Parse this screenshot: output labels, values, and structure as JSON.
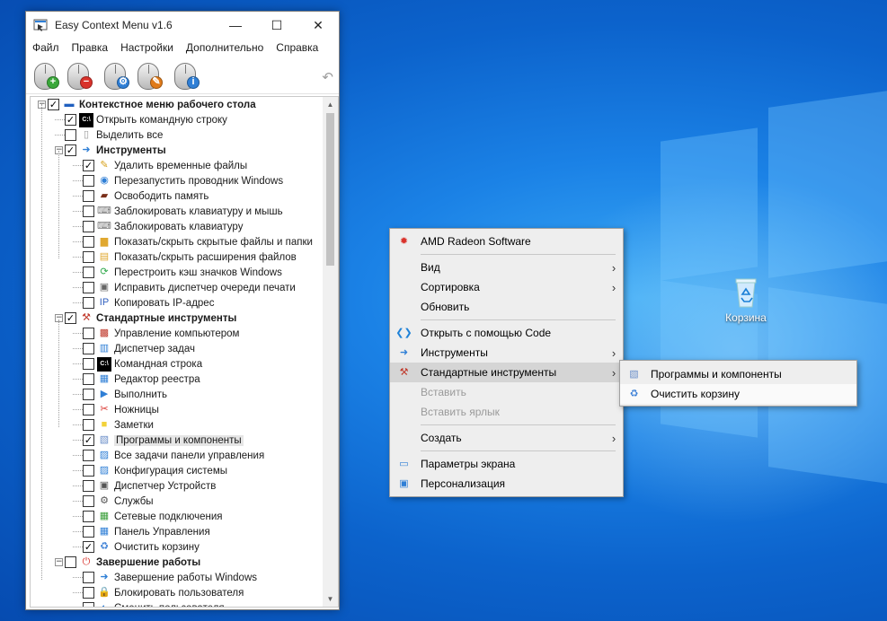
{
  "window": {
    "title": "Easy Context Menu v1.6",
    "controls": {
      "minimize": "—",
      "maximize": "☐",
      "close": "✕"
    }
  },
  "menubar": [
    "Файл",
    "Правка",
    "Настройки",
    "Дополнительно",
    "Справка"
  ],
  "toolbar": {
    "buttons": [
      {
        "name": "add-menu-button",
        "badge": "+",
        "badge_color": "#3aa83a"
      },
      {
        "name": "remove-menu-button",
        "badge": "−",
        "badge_color": "#d9322b"
      },
      {
        "name": "settings-button",
        "badge": "⚙",
        "badge_color": "#2f7fd6"
      },
      {
        "name": "clean-button",
        "badge": "✎",
        "badge_color": "#e07b1a"
      },
      {
        "name": "info-button",
        "badge": "i",
        "badge_color": "#2f7fd6"
      }
    ],
    "undo_icon": "undo-icon"
  },
  "tree": [
    {
      "label": "Контекстное меню рабочего стола",
      "level": 0,
      "checked": true,
      "bold": true,
      "expander": "−",
      "icon": "desktop-icon"
    },
    {
      "label": "Открыть командную строку",
      "level": 1,
      "checked": true,
      "icon": "cmd-icon"
    },
    {
      "label": "Выделить все",
      "level": 1,
      "checked": false,
      "icon": "page-icon"
    },
    {
      "label": "Инструменты",
      "level": 1,
      "checked": true,
      "bold": true,
      "expander": "−",
      "icon": "arrow-icon"
    },
    {
      "label": "Удалить временные файлы",
      "level": 2,
      "checked": true,
      "icon": "broom-icon"
    },
    {
      "label": "Перезапустить проводник Windows",
      "level": 2,
      "checked": false,
      "icon": "globe-icon"
    },
    {
      "label": "Освободить память",
      "level": 2,
      "checked": false,
      "icon": "memory-icon"
    },
    {
      "label": "Заблокировать клавиатуру и мышь",
      "level": 2,
      "checked": false,
      "icon": "keyboard-icon"
    },
    {
      "label": "Заблокировать клавиатуру",
      "level": 2,
      "checked": false,
      "icon": "keyboard-lock-icon"
    },
    {
      "label": "Показать/скрыть скрытые файлы и папки",
      "level": 2,
      "checked": false,
      "icon": "folder-icon"
    },
    {
      "label": "Показать/скрыть расширения файлов",
      "level": 2,
      "checked": false,
      "icon": "file-icon"
    },
    {
      "label": "Перестроить кэш значков Windows",
      "level": 2,
      "checked": false,
      "icon": "refresh-icon"
    },
    {
      "label": "Исправить диспетчер очереди печати",
      "level": 2,
      "checked": false,
      "icon": "printer-icon"
    },
    {
      "label": "Копировать IP-адрес",
      "level": 2,
      "checked": false,
      "icon": "network-icon"
    },
    {
      "label": "Стандартные инструменты",
      "level": 1,
      "checked": true,
      "bold": true,
      "expander": "−",
      "icon": "tools-icon"
    },
    {
      "label": "Управление компьютером",
      "level": 2,
      "checked": false,
      "icon": "computer-manage-icon"
    },
    {
      "label": "Диспетчер задач",
      "level": 2,
      "checked": false,
      "icon": "task-manager-icon"
    },
    {
      "label": "Командная строка",
      "level": 2,
      "checked": false,
      "icon": "cmd-icon"
    },
    {
      "label": "Редактор реестра",
      "level": 2,
      "checked": false,
      "icon": "registry-icon"
    },
    {
      "label": "Выполнить",
      "level": 2,
      "checked": false,
      "icon": "run-icon"
    },
    {
      "label": "Ножницы",
      "level": 2,
      "checked": false,
      "icon": "scissors-icon"
    },
    {
      "label": "Заметки",
      "level": 2,
      "checked": false,
      "icon": "notes-icon"
    },
    {
      "label": "Программы и компоненты",
      "level": 2,
      "checked": true,
      "selected": true,
      "icon": "programs-icon"
    },
    {
      "label": "Все задачи панели управления",
      "level": 2,
      "checked": false,
      "icon": "control-tasks-icon"
    },
    {
      "label": "Конфигурация системы",
      "level": 2,
      "checked": false,
      "icon": "msconfig-icon"
    },
    {
      "label": "Диспетчер Устройств",
      "level": 2,
      "checked": false,
      "icon": "device-manager-icon"
    },
    {
      "label": "Службы",
      "level": 2,
      "checked": false,
      "icon": "services-icon"
    },
    {
      "label": "Сетевые подключения",
      "level": 2,
      "checked": false,
      "icon": "network-connections-icon"
    },
    {
      "label": "Панель Управления",
      "level": 2,
      "checked": false,
      "icon": "control-panel-icon"
    },
    {
      "label": "Очистить корзину",
      "level": 2,
      "checked": true,
      "icon": "recycle-bin-icon"
    },
    {
      "label": "Завершение работы",
      "level": 1,
      "checked": false,
      "bold": true,
      "expander": "−",
      "icon": "power-icon"
    },
    {
      "label": "Завершение работы Windows",
      "level": 2,
      "checked": false,
      "icon": "shutdown-icon"
    },
    {
      "label": "Блокировать пользователя",
      "level": 2,
      "checked": false,
      "icon": "lock-user-icon"
    },
    {
      "label": "Сменить пользователя",
      "level": 2,
      "checked": false,
      "icon": "switch-user-icon"
    }
  ],
  "context_menu": {
    "items": [
      {
        "type": "item",
        "label": "AMD Radeon Software",
        "icon": "amd-icon"
      },
      {
        "type": "sep"
      },
      {
        "type": "item",
        "label": "Вид",
        "submenu": true
      },
      {
        "type": "item",
        "label": "Сортировка",
        "submenu": true
      },
      {
        "type": "item",
        "label": "Обновить"
      },
      {
        "type": "sep"
      },
      {
        "type": "item",
        "label": "Открыть с помощью Code",
        "icon": "vscode-icon"
      },
      {
        "type": "item",
        "label": "Инструменты",
        "submenu": true,
        "icon": "arrow-icon"
      },
      {
        "type": "item",
        "label": "Стандартные инструменты",
        "submenu": true,
        "icon": "tools-icon",
        "highlight": true
      },
      {
        "type": "item",
        "label": "Вставить",
        "disabled": true
      },
      {
        "type": "item",
        "label": "Вставить ярлык",
        "disabled": true
      },
      {
        "type": "sep"
      },
      {
        "type": "item",
        "label": "Создать",
        "submenu": true
      },
      {
        "type": "sep"
      },
      {
        "type": "item",
        "label": "Параметры экрана",
        "icon": "display-icon"
      },
      {
        "type": "item",
        "label": "Персонализация",
        "icon": "personalize-icon"
      }
    ],
    "submenu_arrow": "›"
  },
  "submenu": {
    "items": [
      {
        "label": "Программы и компоненты",
        "icon": "programs-icon"
      },
      {
        "label": "Очистить корзину",
        "icon": "recycle-bin-icon",
        "highlight": true
      }
    ]
  },
  "desktop": {
    "icon_label": "Корзина",
    "colors": {
      "wallpaper": "#0c63cc",
      "accent": "#1b82e6"
    }
  }
}
